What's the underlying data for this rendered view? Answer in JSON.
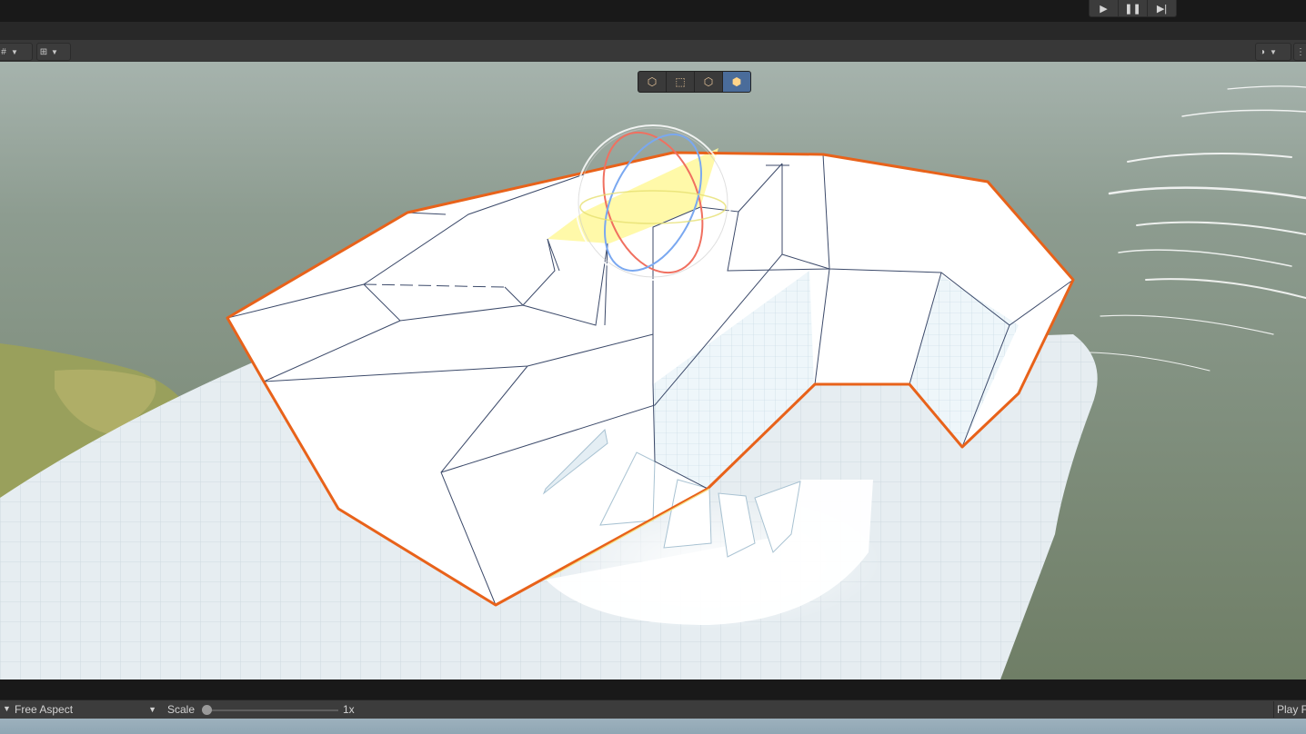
{
  "toolbar": {
    "play_icon": "play-icon",
    "pause_icon": "pause-icon",
    "step_icon": "step-icon"
  },
  "scene_toolbar": {
    "snap_icon": "grid-snap-icon",
    "increment_icon": "increment-snap-icon",
    "shading_icon": "shading-mode-icon"
  },
  "overlay_tools": [
    {
      "icon": "object-mode-icon"
    },
    {
      "icon": "vertex-mode-icon"
    },
    {
      "icon": "edge-mode-icon"
    },
    {
      "icon": "face-mode-icon",
      "active": true
    }
  ],
  "game_toolbar": {
    "aspect": "Free Aspect",
    "scale_label": "Scale",
    "scale_value": "1x",
    "scale_fraction": 0.0,
    "play_focus": "Play F"
  },
  "colors": {
    "selection_outline": "#e8621a",
    "face_highlight": "#fff8a0",
    "active_tool": "#4a6c9a",
    "toolbar_bg": "#383838",
    "editor_dark": "#191919"
  }
}
